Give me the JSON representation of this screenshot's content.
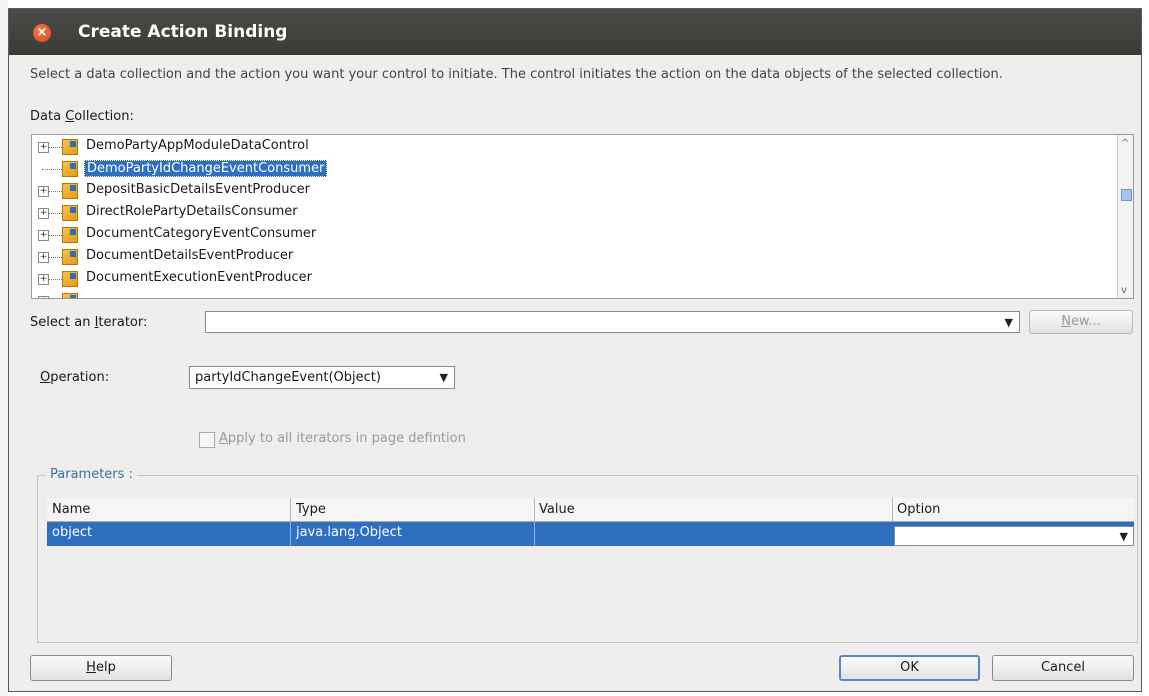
{
  "window": {
    "title": "Create Action Binding"
  },
  "description": "Select a data collection and the action you want your control to initiate. The control initiates the action on the data objects of the selected collection.",
  "data_collection": {
    "label_pre": "Data ",
    "label_key": "C",
    "label_post": "ollection:",
    "items": [
      {
        "label": "DemoPartyAppModuleDataControl",
        "expandable": true,
        "selected": false
      },
      {
        "label": "DemoPartyIdChangeEventConsumer",
        "expandable": false,
        "selected": true
      },
      {
        "label": "DepositBasicDetailsEventProducer",
        "expandable": true,
        "selected": false
      },
      {
        "label": "DirectRolePartyDetailsConsumer",
        "expandable": true,
        "selected": false
      },
      {
        "label": "DocumentCategoryEventConsumer",
        "expandable": true,
        "selected": false
      },
      {
        "label": "DocumentDetailsEventProducer",
        "expandable": true,
        "selected": false
      },
      {
        "label": "DocumentExecutionEventProducer",
        "expandable": true,
        "selected": false
      }
    ]
  },
  "iterator": {
    "label_pre": "Select an ",
    "label_key": "I",
    "label_post": "terator:",
    "value": "",
    "new_pre": "",
    "new_key": "N",
    "new_post": "ew..."
  },
  "operation": {
    "label_pre": "",
    "label_key": "O",
    "label_post": "peration:",
    "value": "partyIdChangeEvent(Object)"
  },
  "apply_all": {
    "pre": "",
    "key": "A",
    "post": "pply to all iterators in page defintion",
    "checked": false
  },
  "parameters": {
    "legend": "Parameters :",
    "columns": [
      "Name",
      "Type",
      "Value",
      "Option"
    ],
    "rows": [
      {
        "name": "object",
        "type": "java.lang.Object",
        "value": "",
        "option": ""
      }
    ]
  },
  "buttons": {
    "help_key": "H",
    "help_post": "elp",
    "ok": "OK",
    "cancel": "Cancel"
  },
  "colors": {
    "selection": "#2f6fbf",
    "titlebar": "#3f3f3c",
    "legend": "#3d6fa8"
  }
}
